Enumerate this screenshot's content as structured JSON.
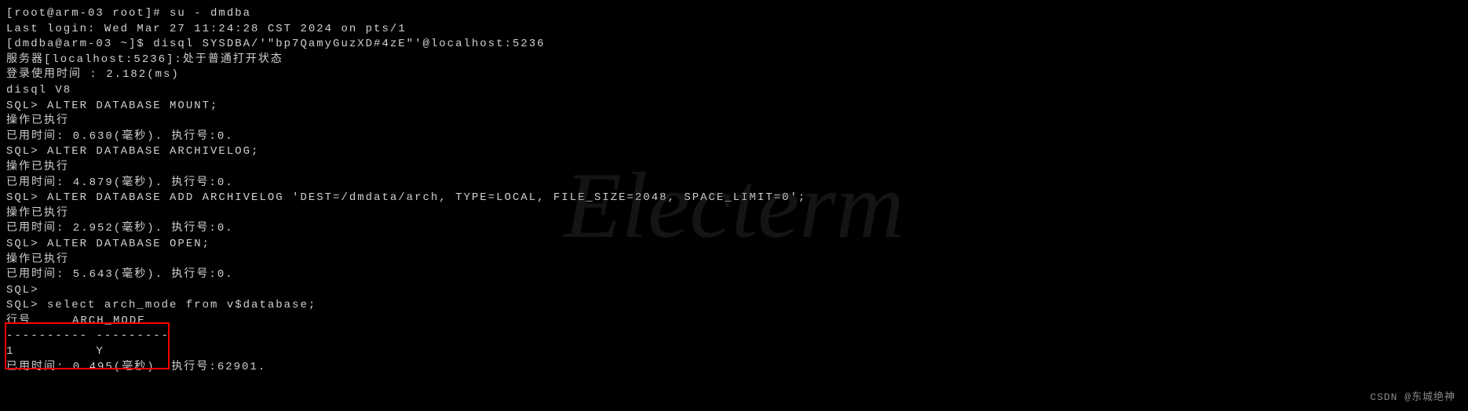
{
  "lines": {
    "l1": "[root@arm-03 root]# su - dmdba",
    "l2": "Last login: Wed Mar 27 11:24:28 CST 2024 on pts/1",
    "l3": "[dmdba@arm-03 ~]$ disql SYSDBA/'\"bp7QamyGuzXD#4zE\"'@localhost:5236",
    "l4": "",
    "l5": "服务器[localhost:5236]:处于普通打开状态",
    "l6": "登录使用时间 : 2.182(ms)",
    "l7": "disql V8",
    "l8": "SQL> ALTER DATABASE MOUNT;",
    "l9": "操作已执行",
    "l10": "已用时间: 0.630(毫秒). 执行号:0.",
    "l11": "SQL> ALTER DATABASE ARCHIVELOG;",
    "l12": "操作已执行",
    "l13": "已用时间: 4.879(毫秒). 执行号:0.",
    "l14": "SQL> ALTER DATABASE ADD ARCHIVELOG 'DEST=/dmdata/arch, TYPE=LOCAL, FILE_SIZE=2048, SPACE_LIMIT=0';",
    "l15": "操作已执行",
    "l16": "已用时间: 2.952(毫秒). 执行号:0.",
    "l17": "SQL> ALTER DATABASE OPEN;",
    "l18": "操作已执行",
    "l19": "已用时间: 5.643(毫秒). 执行号:0.",
    "l20": "SQL>",
    "l21": "SQL> select arch_mode from v$database;",
    "l22": "",
    "l23": "行号     ARCH_MODE",
    "l24": "---------- ---------",
    "l25": "1          Y",
    "l26": "",
    "l27": "已用时间: 0.495(毫秒). 执行号:62901."
  },
  "watermark": "Electerm",
  "attribution": "CSDN @东城绝神"
}
